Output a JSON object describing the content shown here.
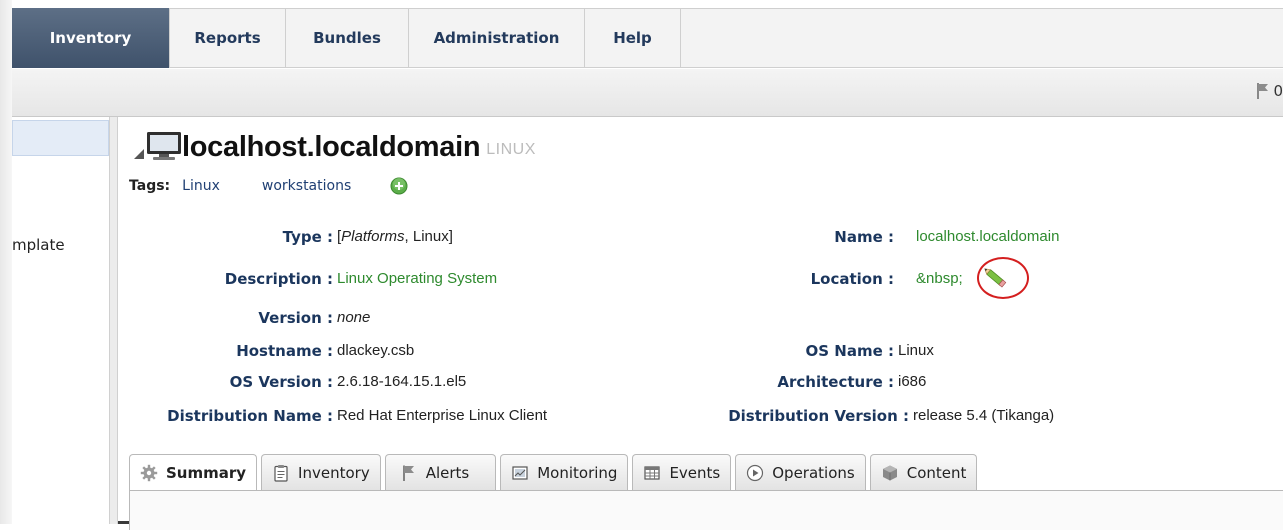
{
  "nav": {
    "items": [
      {
        "label": "Inventory",
        "active": true
      },
      {
        "label": "Reports",
        "active": false
      },
      {
        "label": "Bundles",
        "active": false
      },
      {
        "label": "Administration",
        "active": false
      },
      {
        "label": "Help",
        "active": false
      }
    ]
  },
  "toolbar": {
    "alert_count": "0"
  },
  "tree": {
    "partial_item": "mplate"
  },
  "resource": {
    "title": "localhost.localdomain",
    "type_badge": "LINUX",
    "tags_label": "Tags:",
    "tags": [
      "Linux",
      "workstations"
    ]
  },
  "properties": {
    "type_label": "Type :",
    "type_value_italic": "Platforms",
    "type_value_rest": ", Linux]",
    "type_value_open": "[",
    "description_label": "Description :",
    "description_value": "Linux Operating System",
    "version_label": "Version :",
    "version_value": "none",
    "hostname_label": "Hostname :",
    "hostname_value": "dlackey.csb",
    "os_version_label": "OS Version :",
    "os_version_value": "2.6.18-164.15.1.el5",
    "distribution_name_label": "Distribution Name :",
    "distribution_name_value": "Red Hat Enterprise Linux Client",
    "name_label": "Name :",
    "name_value": "localhost.localdomain",
    "location_label": "Location :",
    "location_value": "&nbsp;",
    "os_name_label": "OS Name :",
    "os_name_value": "Linux",
    "architecture_label": "Architecture :",
    "architecture_value": "i686",
    "distribution_version_label": "Distribution Version :",
    "distribution_version_value": "release 5.4 (Tikanga)"
  },
  "tabs": [
    {
      "label": "Summary",
      "icon": "gear-icon",
      "active": true
    },
    {
      "label": "Inventory",
      "icon": "clipboard-icon",
      "active": false
    },
    {
      "label": "Alerts",
      "icon": "flag-icon",
      "active": false
    },
    {
      "label": "Monitoring",
      "icon": "monitor-chart-icon",
      "active": false
    },
    {
      "label": "Events",
      "icon": "events-table-icon",
      "active": false
    },
    {
      "label": "Operations",
      "icon": "play-circle-icon",
      "active": false
    },
    {
      "label": "Content",
      "icon": "package-icon",
      "active": false
    }
  ],
  "colors": {
    "nav_active": "#4a5d76",
    "nav_text": "#233a5c",
    "label_blue": "#1b365d",
    "link_green": "#2e8a2e",
    "highlight_red": "#d41f1f"
  }
}
